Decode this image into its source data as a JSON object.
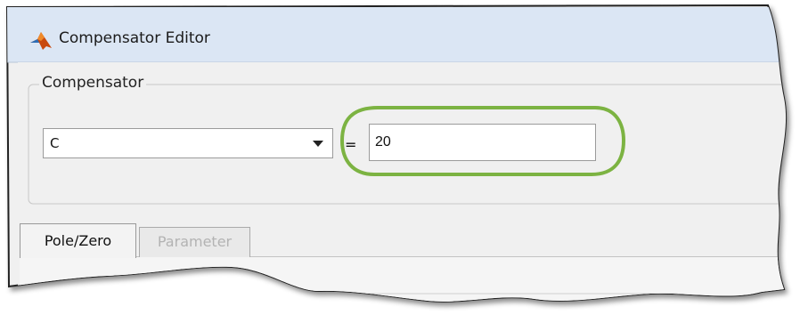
{
  "window": {
    "title": "Compensator Editor",
    "icon": "matlab-logo-icon"
  },
  "compensator_group": {
    "legend": "Compensator",
    "selector": {
      "value": "C",
      "icon": "chevron-down-icon"
    },
    "equals_sign": "=",
    "input": {
      "value": "20"
    }
  },
  "tabs": [
    {
      "label": "Pole/Zero",
      "active": true
    },
    {
      "label": "Parameter",
      "active": false
    }
  ],
  "colors": {
    "title_bar": "#dbe6f4",
    "panel": "#f0f0f0",
    "highlight_ellipse": "#7cb342"
  }
}
